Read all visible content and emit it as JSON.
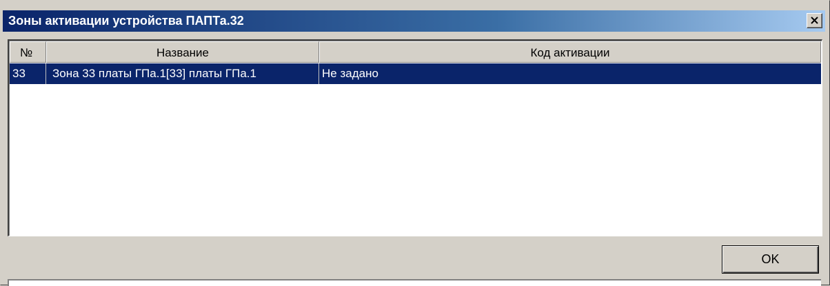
{
  "window": {
    "title": "Зоны активации устройства ПАПТа.32"
  },
  "list": {
    "columns": [
      {
        "label": "№"
      },
      {
        "label": "Название"
      },
      {
        "label": "Код активации"
      }
    ],
    "rows": [
      {
        "number": "33",
        "name": "Зона 33 платы ГПа.1[33] платы ГПа.1",
        "activation_code": "Не задано",
        "selected": true
      }
    ]
  },
  "buttons": {
    "ok_label": "OK"
  },
  "colors": {
    "titlebar_start": "#0a246a",
    "titlebar_end": "#a6caf0",
    "selection": "#0a246a",
    "face": "#d4d0c8"
  },
  "icons": {
    "close": "close-icon"
  }
}
